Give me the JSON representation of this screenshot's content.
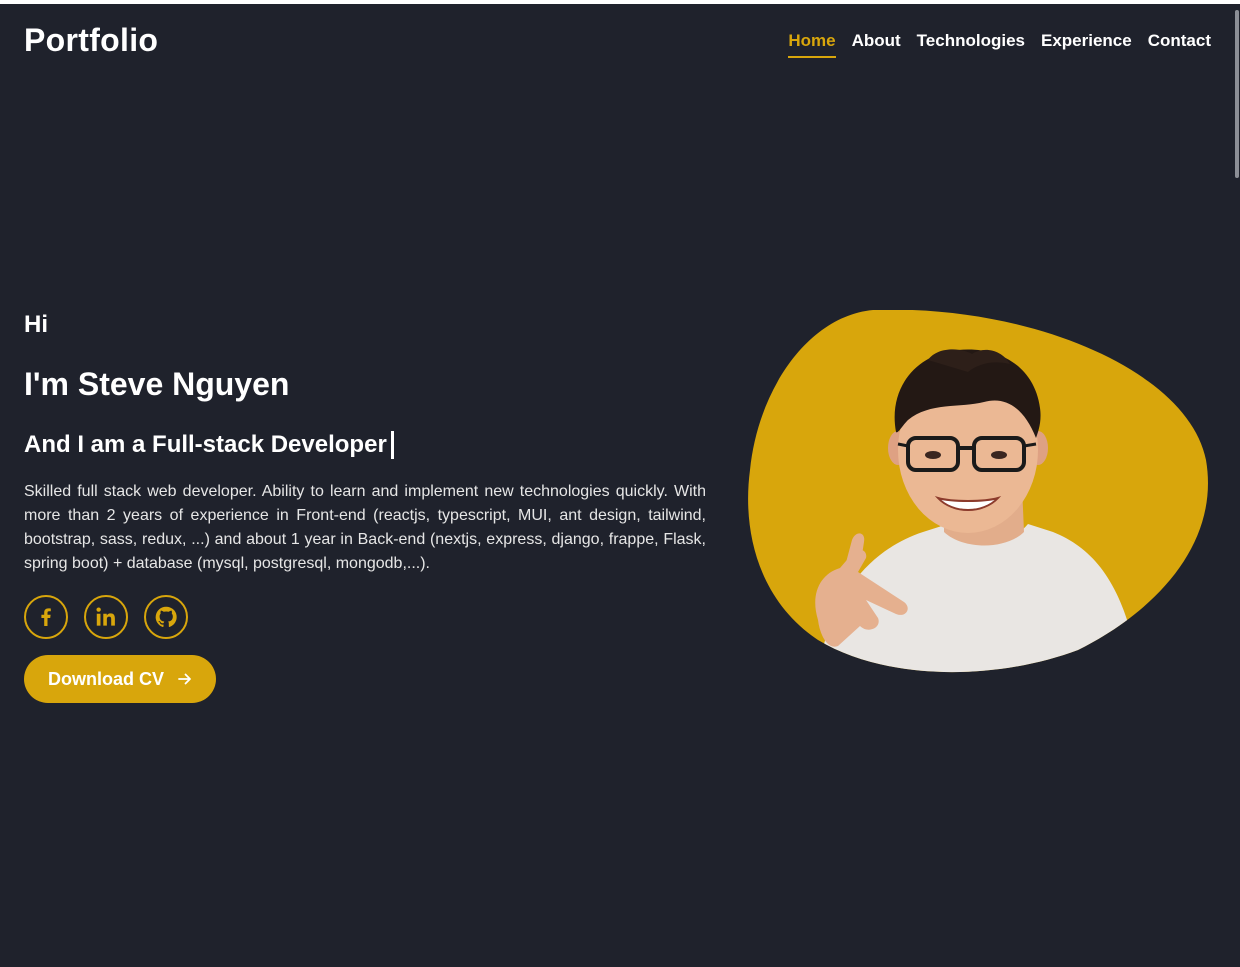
{
  "header": {
    "logo": "Portfolio",
    "nav": [
      {
        "label": "Home",
        "active": true
      },
      {
        "label": "About",
        "active": false
      },
      {
        "label": "Technologies",
        "active": false
      },
      {
        "label": "Experience",
        "active": false
      },
      {
        "label": "Contact",
        "active": false
      }
    ]
  },
  "hero": {
    "greeting": "Hi",
    "name": "I'm Steve Nguyen",
    "role": "And I am a Full-stack Developer",
    "description": "Skilled full stack web developer. Ability to learn and implement new technologies quickly. With more than 2 years of experience in Front-end (reactjs, typescript, MUI, ant design, tailwind, bootstrap, sass, redux, ...) and about 1 year in Back-end (nextjs, express, django, frappe, Flask, spring boot) + database (mysql, postgresql, mongodb,...).",
    "socials": [
      {
        "icon": "facebook-icon"
      },
      {
        "icon": "linkedin-icon"
      },
      {
        "icon": "github-icon"
      }
    ],
    "cta_label": "Download CV",
    "cta_icon": "arrow-right-icon"
  },
  "colors": {
    "background": "#1f222c",
    "accent": "#d8a60c",
    "text": "#ffffff"
  }
}
